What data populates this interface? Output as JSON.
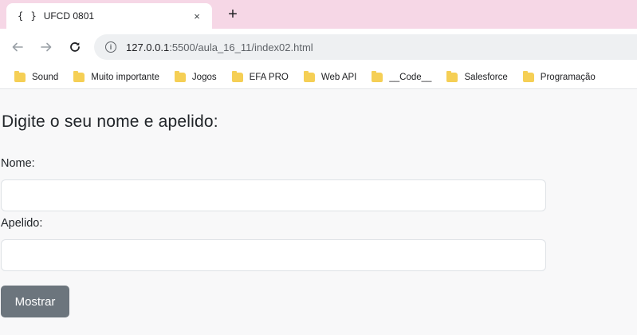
{
  "browser": {
    "tab": {
      "icon_text": "{ }",
      "title": "UFCD 0801",
      "close": "×"
    },
    "new_tab": "+",
    "address": {
      "host": "127.0.0.1",
      "rest": ":5500/aula_16_11/index02.html"
    },
    "bookmarks": [
      "Sound",
      "Muito importante",
      "Jogos",
      "EFA PRO",
      "Web API",
      "__Code__",
      "Salesforce",
      "Programação"
    ]
  },
  "page": {
    "heading": "Digite o seu nome e apelido:",
    "name_label": "Nome:",
    "surname_label": "Apelido:",
    "name_value": "",
    "surname_value": "",
    "button_label": "Mostrar"
  },
  "colors": {
    "tabstrip": "#f6d7e6",
    "page_background": "#f8f8f9",
    "button": "#6c757d",
    "folder": "#f5cf55"
  }
}
